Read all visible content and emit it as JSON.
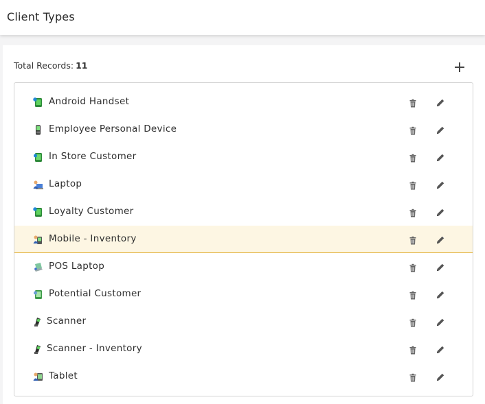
{
  "header": {
    "title": "Client Types"
  },
  "summary": {
    "label": "Total Records:",
    "count": "11"
  },
  "actions": {
    "add_icon": "plus-icon",
    "delete_icon": "trash-icon",
    "edit_icon": "pencil-icon"
  },
  "colors": {
    "selected_bg": "#fdf6e3",
    "selected_border": "#e3b23c"
  },
  "client_types": [
    {
      "label": "Android Handset",
      "icon": "android-handset-icon",
      "selected": false
    },
    {
      "label": "Employee Personal Device",
      "icon": "mobile-phone-icon",
      "selected": false
    },
    {
      "label": "In Store Customer",
      "icon": "in-store-customer-icon",
      "selected": false
    },
    {
      "label": "Laptop",
      "icon": "laptop-user-icon",
      "selected": false
    },
    {
      "label": "Loyalty Customer",
      "icon": "loyalty-customer-icon",
      "selected": false
    },
    {
      "label": "Mobile - Inventory",
      "icon": "mobile-user-icon",
      "selected": true
    },
    {
      "label": "POS Laptop",
      "icon": "pos-laptop-icon",
      "selected": false
    },
    {
      "label": "Potential Customer",
      "icon": "potential-customer-icon",
      "selected": false
    },
    {
      "label": "Scanner",
      "icon": "scanner-icon",
      "selected": false
    },
    {
      "label": "Scanner - Inventory",
      "icon": "scanner-icon",
      "selected": false
    },
    {
      "label": "Tablet",
      "icon": "tablet-user-icon",
      "selected": false
    }
  ]
}
